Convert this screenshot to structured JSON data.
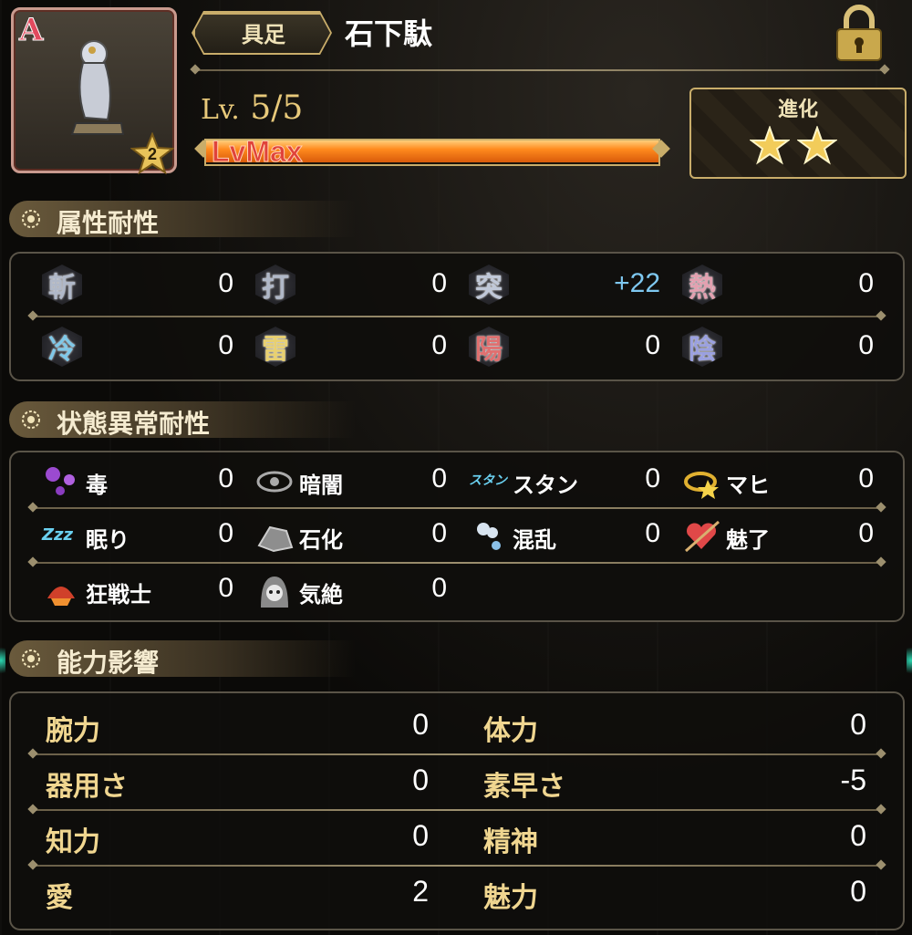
{
  "header": {
    "rank": "A",
    "rarity_badge": "2",
    "type_label": "具足",
    "item_name": "石下駄",
    "level_prefix": "Lv.",
    "level": "5/5",
    "xp_bar_text": "LvMax",
    "xp_fill_fraction": 1.0,
    "evolution_label": "進化",
    "evolution_stars": 2
  },
  "attribute_resistance": {
    "title": "属性耐性",
    "rows": [
      [
        {
          "kanji": "斬",
          "value": "0",
          "color": "#b0b8c8"
        },
        {
          "kanji": "打",
          "value": "0",
          "color": "#b0b8c8"
        },
        {
          "kanji": "突",
          "value": "+22",
          "color": "#c0c8d8"
        },
        {
          "kanji": "熱",
          "value": "0",
          "color": "#e3a0b0"
        }
      ],
      [
        {
          "kanji": "冷",
          "value": "0",
          "color": "#7fc8e8"
        },
        {
          "kanji": "雷",
          "value": "0",
          "color": "#e8d070"
        },
        {
          "kanji": "陽",
          "value": "0",
          "color": "#e07070"
        },
        {
          "kanji": "陰",
          "value": "0",
          "color": "#9aa0e0"
        }
      ]
    ]
  },
  "status_resistance": {
    "title": "状態異常耐性",
    "rows": [
      [
        {
          "label": "毒",
          "value": "0",
          "icon": "poison-icon"
        },
        {
          "label": "暗闇",
          "value": "0",
          "icon": "darkness-eye-icon"
        },
        {
          "label": "スタン",
          "value": "0",
          "icon": "stun-icon",
          "icon_text": "スタン"
        },
        {
          "label": "マヒ",
          "value": "0",
          "icon": "paralysis-icon"
        }
      ],
      [
        {
          "label": "眠り",
          "value": "0",
          "icon": "sleep-icon",
          "icon_text": "Zzz"
        },
        {
          "label": "石化",
          "value": "0",
          "icon": "petrify-icon"
        },
        {
          "label": "混乱",
          "value": "0",
          "icon": "confusion-icon"
        },
        {
          "label": "魅了",
          "value": "0",
          "icon": "charm-heart-icon"
        }
      ],
      [
        {
          "label": "狂戦士",
          "value": "0",
          "icon": "berserk-icon"
        },
        {
          "label": "気絶",
          "value": "0",
          "icon": "faint-skull-icon"
        }
      ]
    ]
  },
  "ability_effects": {
    "title": "能力影響",
    "rows": [
      [
        {
          "label": "腕力",
          "value": "0"
        },
        {
          "label": "体力",
          "value": "0"
        }
      ],
      [
        {
          "label": "器用さ",
          "value": "0"
        },
        {
          "label": "素早さ",
          "value": "-5"
        }
      ],
      [
        {
          "label": "知力",
          "value": "0"
        },
        {
          "label": "精神",
          "value": "0"
        }
      ],
      [
        {
          "label": "愛",
          "value": "2"
        },
        {
          "label": "魅力",
          "value": "0"
        }
      ]
    ]
  }
}
